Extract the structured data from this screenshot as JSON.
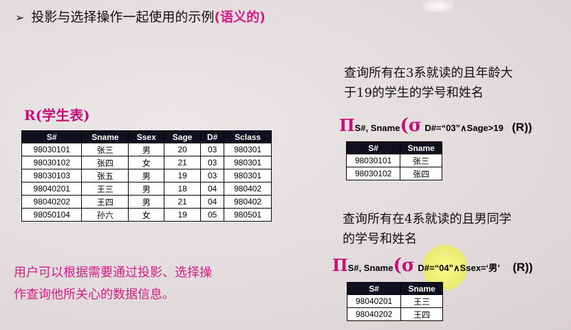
{
  "title": {
    "bullet": "➢",
    "main": "投影与选择操作一起使用的示例",
    "highlight": "(语义的)"
  },
  "student_table": {
    "label": "R(学生表)",
    "columns": [
      "S#",
      "Sname",
      "Ssex",
      "Sage",
      "D#",
      "Sclass"
    ],
    "rows": [
      [
        "98030101",
        "张三",
        "男",
        "20",
        "03",
        "980301"
      ],
      [
        "98030102",
        "张四",
        "女",
        "21",
        "03",
        "980301"
      ],
      [
        "98030103",
        "张五",
        "男",
        "19",
        "03",
        "980301"
      ],
      [
        "98040201",
        "王三",
        "男",
        "18",
        "04",
        "980402"
      ],
      [
        "98040202",
        "王四",
        "男",
        "21",
        "04",
        "980402"
      ],
      [
        "98050104",
        "孙六",
        "女",
        "19",
        "05",
        "980501"
      ]
    ]
  },
  "query1": {
    "question_line1": "查询所有在3系就读的且年龄大",
    "question_line2": "于19的学生的学号和姓名",
    "pi": "Π",
    "pi_sub": "S#, Sname",
    "open": "(",
    "sigma": "σ",
    "sigma_sub": "D#=“03”∧Sage>19",
    "tail": "(R))",
    "result_columns": [
      "S#",
      "Sname"
    ],
    "result_rows": [
      [
        "98030101",
        "张三"
      ],
      [
        "98030102",
        "张四"
      ]
    ]
  },
  "query2": {
    "question_line1": "查询所有在4系就读的且男同学",
    "question_line2": "的学号和姓名",
    "pi": "Π",
    "pi_sub": "S#, Sname",
    "open": "(",
    "sigma": "σ",
    "sigma_sub": "D#=“04”∧Ssex=‘男’",
    "tail": "(R))",
    "result_columns": [
      "S#",
      "Sname"
    ],
    "result_rows": [
      [
        "98040201",
        "王三"
      ],
      [
        "98040202",
        "王四"
      ]
    ]
  },
  "note": {
    "line1": "用户可以根据需要通过投影、选择操",
    "line2": "作查询他所关心的数据信息。"
  },
  "colors": {
    "accent": "#d81a8a",
    "header_bg": "#101020"
  }
}
